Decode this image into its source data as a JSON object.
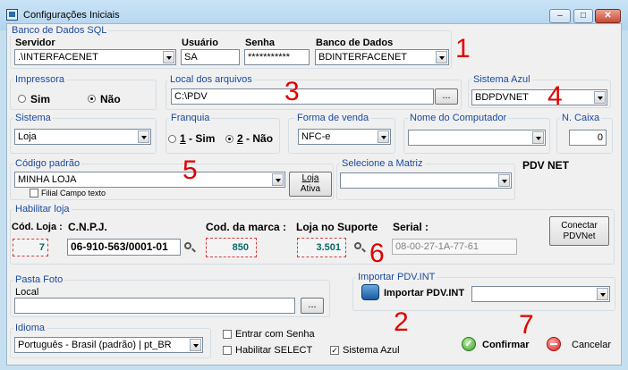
{
  "window": {
    "title": "Configurações Iniciais"
  },
  "sql_group": {
    "title": "Banco de Dados SQL",
    "servidor_label": "Servidor",
    "servidor_value": ".\\INTERFACENET",
    "usuario_label": "Usuário",
    "usuario_value": "SA",
    "senha_label": "Senha",
    "senha_value": "***********",
    "banco_label": "Banco de Dados",
    "banco_value": "BDINTERFACENET"
  },
  "impressora": {
    "title": "Impressora",
    "sim": "Sim",
    "nao": "Não",
    "selected": "nao"
  },
  "local_arquivos": {
    "title": "Local dos arquivos",
    "value": "C:\\PDV",
    "browse": "..."
  },
  "sistema_azul": {
    "title": "Sistema Azul",
    "value": "BDPDVNET"
  },
  "sistema": {
    "title": "Sistema",
    "value": "Loja"
  },
  "franquia": {
    "title": "Franquia",
    "opt1_key": "1",
    "opt1_text": " - Sim",
    "opt2_key": "2",
    "opt2_text": " - Não",
    "selected": "2"
  },
  "forma_venda": {
    "title": "Forma de venda",
    "value": "NFC-e"
  },
  "nome_computador": {
    "title": "Nome do Computador",
    "value": ""
  },
  "n_caixa": {
    "title": "N. Caixa",
    "value": "0"
  },
  "codigo_padrao": {
    "title": "Código padrão",
    "value": "MINHA LOJA",
    "filial_check": "Filial Campo texto",
    "loja_ativa_line1": "Loja",
    "loja_ativa_line2": "Ativa"
  },
  "matriz": {
    "title": "Selecione a Matriz",
    "value": ""
  },
  "pdv_net_label": "PDV NET",
  "habilitar_loja": {
    "title": "Habilitar loja",
    "cod_loja_label": "Cód. Loja :",
    "cod_loja_value": "7",
    "cnpj_label": "C.N.P.J.",
    "cnpj_value": "06-910-563/0001-01",
    "cod_marca_label": "Cod. da marca :",
    "cod_marca_value": "850",
    "loja_suporte_label": "Loja no Suporte",
    "loja_suporte_value": "3.501",
    "serial_label": "Serial :",
    "serial_value": "08-00-27-1A-77-61",
    "conectar_line1": "Conectar",
    "conectar_line2": "PDVNet"
  },
  "pasta_foto": {
    "title": "Pasta Foto",
    "local_label": "Local",
    "value": "",
    "browse": "..."
  },
  "importar": {
    "title": "Importar PDV.INT",
    "button_label": "Importar PDV.INT",
    "combo_value": ""
  },
  "idioma": {
    "title": "Idioma",
    "value": "Português - Brasil (padrão) | pt_BR"
  },
  "options": {
    "entrar_senha": "Entrar com Senha",
    "habilitar_select": "Habilitar SELECT",
    "sistema_azul": "Sistema Azul"
  },
  "actions": {
    "confirmar": "Confirmar",
    "cancelar": "Cancelar"
  },
  "annotations": {
    "a1": "1",
    "a2": "2",
    "a3": "3",
    "a4": "4",
    "a5": "5",
    "a6": "6",
    "a7": "7"
  },
  "colors": {
    "annotation": "#e00000",
    "group_title": "#1a4aa0",
    "confirm_green": "#3a9a2a",
    "cancel_red": "#d02020"
  }
}
